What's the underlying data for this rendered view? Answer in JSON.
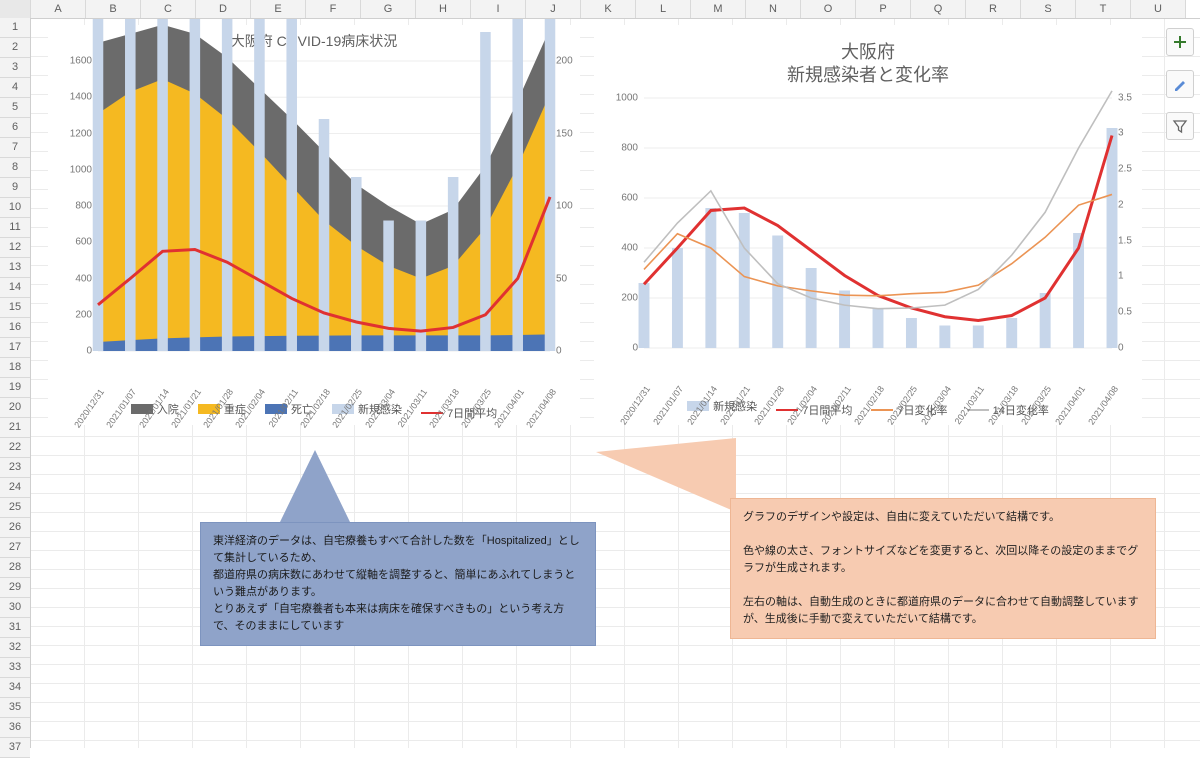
{
  "columns": [
    "",
    "A",
    "B",
    "C",
    "D",
    "E",
    "F",
    "G",
    "H",
    "I",
    "J",
    "K",
    "L",
    "M",
    "N",
    "O",
    "P",
    "Q",
    "R",
    "S",
    "T",
    "U"
  ],
  "rows": 37,
  "chart1": {
    "title": "大阪府 COVID-19病床状況",
    "legend": [
      "入院",
      "重症",
      "死亡",
      "新規感染",
      "7日間平均"
    ]
  },
  "chart2": {
    "title_line1": "大阪府",
    "title_line2": "新規感染者と変化率",
    "legend": [
      "新規感染",
      "7日間平均",
      "7日変化率",
      "14日変化率"
    ]
  },
  "callout_blue": "東洋経済のデータは、自宅療養もすべて合計した数を「Hospitalized」として集計しているため、\n都道府県の病床数にあわせて縦軸を調整すると、簡単にあふれてしまうという難点があります。\nとりあえず「自宅療養者も本来は病床を確保すべきもの」という考え方で、そのままにしています",
  "callout_orange": "グラフのデザインや設定は、自由に変えていただいて結構です。\n\n色や線の太さ、フォントサイズなどを変更すると、次回以降その設定のままでグラフが生成されます。\n\n左右の軸は、自動生成のときに都道府県のデータに合わせて自動調整していますが、生成後に手動で変えていただいて結構です。",
  "tools": {
    "plus": "chart-elements",
    "brush": "chart-styles",
    "filter": "chart-filters"
  },
  "chart_data": [
    {
      "id": "chart1",
      "type": "area+bar+line (combo)",
      "title": "大阪府 COVID-19病床状況",
      "x_categories": [
        "2020/12/31",
        "2021/01/07",
        "2021/01/14",
        "2021/01/21",
        "2021/01/28",
        "2021/02/04",
        "2021/02/11",
        "2021/02/18",
        "2021/02/25",
        "2021/03/04",
        "2021/03/11",
        "2021/03/18",
        "2021/03/25",
        "2021/04/01",
        "2021/04/08"
      ],
      "y_left": {
        "label": "",
        "min": 0,
        "max": 1600,
        "ticks": [
          0,
          200,
          400,
          600,
          800,
          1000,
          1200,
          1400,
          1600
        ]
      },
      "y_right": {
        "label": "",
        "min": 0,
        "max": 200,
        "ticks": [
          0,
          50,
          100,
          150,
          200
        ]
      },
      "series": [
        {
          "name": "入院",
          "type": "stacked-area",
          "axis": "left",
          "color": "#6b6b6b",
          "values": [
            1700,
            1750,
            1800,
            1750,
            1620,
            1450,
            1280,
            1100,
            920,
            800,
            700,
            780,
            1020,
            1380,
            1780
          ]
        },
        {
          "name": "重症",
          "type": "stacked-area",
          "axis": "left",
          "color": "#f5b921",
          "values": [
            1310,
            1430,
            1500,
            1420,
            1280,
            1100,
            910,
            720,
            580,
            470,
            400,
            470,
            680,
            1020,
            1420
          ]
        },
        {
          "name": "死亡",
          "type": "stacked-area",
          "axis": "left",
          "color": "#4c74b5",
          "values": [
            50,
            60,
            70,
            75,
            80,
            82,
            84,
            85,
            86,
            86,
            86,
            86,
            86,
            88,
            92
          ]
        },
        {
          "name": "新規感染",
          "type": "bar",
          "axis": "right",
          "color": "#c7d6ea",
          "values": [
            260,
            400,
            560,
            540,
            450,
            320,
            230,
            160,
            120,
            90,
            90,
            120,
            220,
            460,
            880
          ]
        },
        {
          "name": "7日間平均",
          "type": "line",
          "axis": "left",
          "color": "#e03131",
          "values": [
            255,
            400,
            550,
            560,
            490,
            390,
            290,
            210,
            160,
            125,
            110,
            130,
            200,
            400,
            850
          ]
        }
      ]
    },
    {
      "id": "chart2",
      "type": "bar+line (combo)",
      "title": "大阪府 新規感染者と変化率",
      "x_categories": [
        "2020/12/31",
        "2021/01/07",
        "2021/01/14",
        "2021/01/21",
        "2021/01/28",
        "2021/02/04",
        "2021/02/11",
        "2021/02/18",
        "2021/02/25",
        "2021/03/04",
        "2021/03/11",
        "2021/03/18",
        "2021/03/25",
        "2021/04/01",
        "2021/04/08"
      ],
      "y_left": {
        "label": "",
        "min": 0,
        "max": 1000,
        "ticks": [
          0,
          200,
          400,
          600,
          800,
          1000
        ]
      },
      "y_right": {
        "label": "",
        "min": 0,
        "max": 3.5,
        "ticks": [
          0,
          0.5,
          1,
          1.5,
          2,
          2.5,
          3,
          3.5
        ]
      },
      "series": [
        {
          "name": "新規感染",
          "type": "bar",
          "axis": "left",
          "color": "#c7d6ea",
          "values": [
            260,
            400,
            560,
            540,
            450,
            320,
            230,
            160,
            120,
            90,
            90,
            120,
            220,
            460,
            880
          ]
        },
        {
          "name": "7日間平均",
          "type": "line",
          "axis": "left",
          "color": "#e03131",
          "values": [
            255,
            400,
            550,
            560,
            490,
            390,
            290,
            210,
            160,
            125,
            110,
            130,
            200,
            400,
            850
          ]
        },
        {
          "name": "7日変化率",
          "type": "line",
          "axis": "right",
          "color": "#eb9454",
          "values": [
            1.1,
            1.6,
            1.4,
            1.0,
            0.87,
            0.8,
            0.74,
            0.73,
            0.76,
            0.78,
            0.88,
            1.18,
            1.55,
            2.0,
            2.15
          ]
        },
        {
          "name": "14日変化率",
          "type": "line",
          "axis": "right",
          "color": "#bfbfbf",
          "values": [
            1.2,
            1.75,
            2.2,
            1.4,
            0.9,
            0.7,
            0.6,
            0.55,
            0.56,
            0.6,
            0.82,
            1.3,
            1.9,
            2.8,
            3.6
          ]
        }
      ]
    }
  ]
}
